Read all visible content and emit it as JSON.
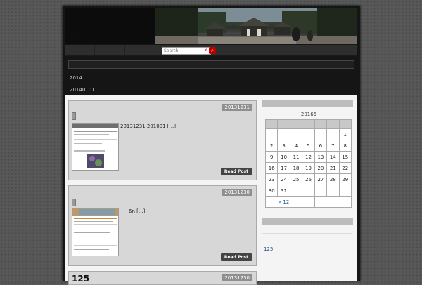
{
  "blog": {
    "title": "- -"
  },
  "search": {
    "placeholder": "Search",
    "clear": "×",
    "button": "⌕"
  },
  "archive": {
    "title": "2014",
    "subtitle": "20140101"
  },
  "posts": [
    {
      "date": "20131231",
      "excerpt": "20131231 201001  [...]",
      "read_more": "Read Post"
    },
    {
      "date": "20131230",
      "excerpt": "6n [...]",
      "read_more": "Read Post"
    },
    {
      "date": "20131230",
      "title": "125"
    }
  ],
  "calendar": {
    "caption": "20165",
    "weeks": [
      [
        "",
        "",
        "",
        "",
        "",
        "",
        "1"
      ],
      [
        "2",
        "3",
        "4",
        "5",
        "6",
        "7",
        "8"
      ],
      [
        "9",
        "10",
        "11",
        "12",
        "13",
        "14",
        "15"
      ],
      [
        "16",
        "17",
        "18",
        "19",
        "20",
        "21",
        "22"
      ],
      [
        "23",
        "24",
        "25",
        "26",
        "27",
        "28",
        "29"
      ],
      [
        "30",
        "31",
        "",
        "",
        "",
        "",
        ""
      ]
    ],
    "prev": "« 12"
  },
  "sidebar": {
    "link": "125"
  }
}
